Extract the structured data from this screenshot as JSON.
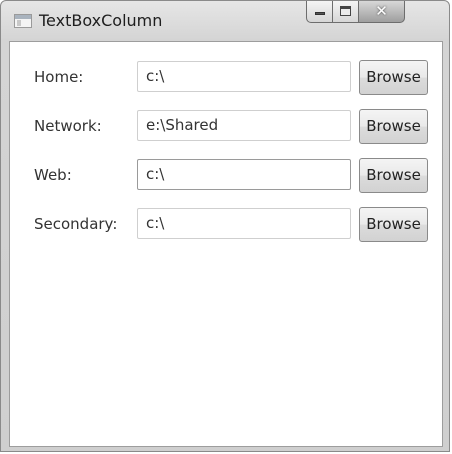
{
  "window": {
    "title": "TextBoxColumn"
  },
  "rows": [
    {
      "label": "Home:",
      "value": "c:\\",
      "button": "Browse"
    },
    {
      "label": "Network:",
      "value": "e:\\Shared",
      "button": "Browse"
    },
    {
      "label": "Web:",
      "value": "c:\\",
      "button": "Browse"
    },
    {
      "label": "Secondary:",
      "value": "c:\\",
      "button": "Browse"
    }
  ],
  "icons": {
    "app": "window-app-icon",
    "minimize": "minimize-icon",
    "maximize": "maximize-icon",
    "close": "close-icon"
  }
}
